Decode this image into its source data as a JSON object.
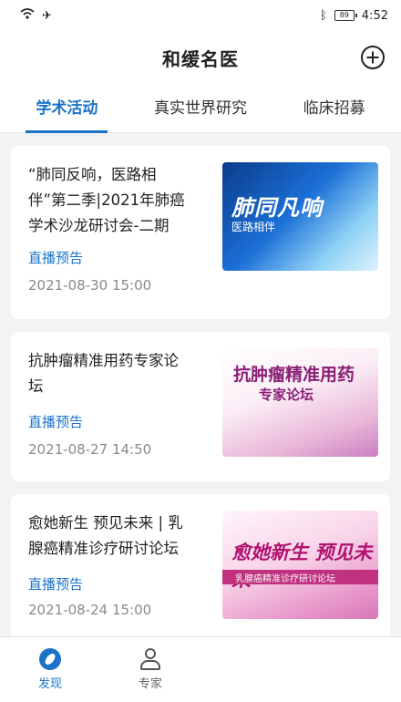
{
  "status_bar": {
    "time": "4:52",
    "battery": "89"
  },
  "header": {
    "title": "和缓名医"
  },
  "tabs": [
    {
      "label": "学术活动"
    },
    {
      "label": "真实世界研究"
    },
    {
      "label": "临床招募"
    }
  ],
  "cards": [
    {
      "title": "“肺同反响，医路相伴”第二季|2021年肺癌学术沙龙研讨会-二期",
      "tag": "直播预告",
      "date": "2021-08-30 15:00",
      "image_main": "肺同凡响",
      "image_sub": "医路相伴"
    },
    {
      "title": "抗肿瘤精准用药专家论坛",
      "tag": "直播预告",
      "date": "2021-08-27 14:50",
      "image_main": "抗肿瘤精准用药",
      "image_sub": "专家论坛"
    },
    {
      "title": "愈她新生  预见未来 | 乳腺癌精准诊疗研讨论坛",
      "tag": "直播预告",
      "date": "2021-08-24 15:00",
      "image_main": "愈她新生 预见未来",
      "image_sub": "乳腺癌精准诊疗研讨论坛"
    }
  ],
  "bottom_nav": [
    {
      "label": "发现",
      "icon": "compass-icon"
    },
    {
      "label": "专家",
      "icon": "doctor-icon"
    }
  ],
  "colors": {
    "accent": "#1a73c8",
    "background": "#f2f3f5"
  }
}
